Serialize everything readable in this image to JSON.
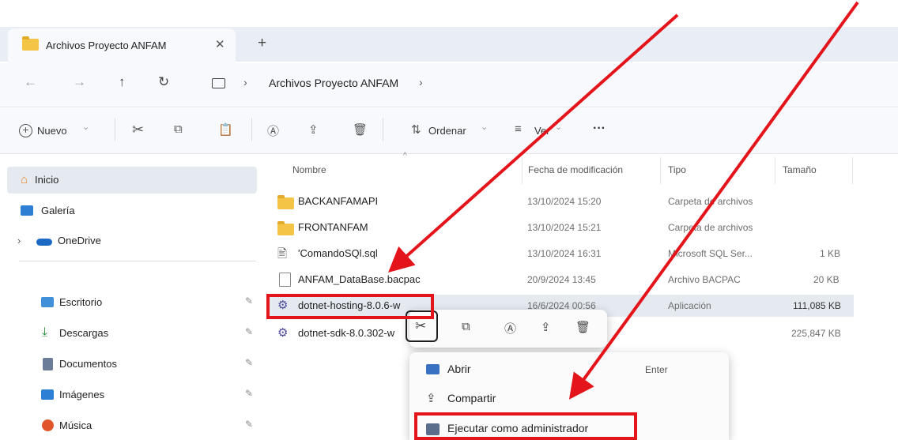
{
  "window": {
    "tab_title": "Archivos Proyecto ANFAM",
    "tab_close": "✕",
    "new_tab": "+"
  },
  "address": {
    "back": "←",
    "forward": "→",
    "up": "↑",
    "refresh": "↻",
    "separator": "›",
    "path_current": "Archivos Proyecto ANFAM"
  },
  "toolbar": {
    "new_label": "Nuevo",
    "sort_label": "Ordenar",
    "view_label": "Ver",
    "more": "···",
    "caret": "⌄"
  },
  "sidebar": {
    "home": "Inicio",
    "gallery": "Galería",
    "onedrive": "OneDrive",
    "expand": "›",
    "pin": "📌",
    "quick_access": [
      {
        "label": "Escritorio",
        "icon": "desktop-icon",
        "color": "#3f8fd9"
      },
      {
        "label": "Descargas",
        "icon": "download-icon",
        "color": "#2a8f3e"
      },
      {
        "label": "Documentos",
        "icon": "documents-icon",
        "color": "#6b7c99"
      },
      {
        "label": "Imágenes",
        "icon": "pictures-icon",
        "color": "#2d7fd4"
      },
      {
        "label": "Música",
        "icon": "music-icon",
        "color": "#e0562a"
      }
    ]
  },
  "columns": {
    "name": "Nombre",
    "modified": "Fecha de modificación",
    "type": "Tipo",
    "size": "Tamaño"
  },
  "files": [
    {
      "name": "BACKANFAMAPI",
      "date": "13/10/2024 15:20",
      "type": "Carpeta de archivos",
      "size": "",
      "icon": "folder-icon"
    },
    {
      "name": "FRONTANFAM",
      "date": "13/10/2024 15:21",
      "type": "Carpeta de archivos",
      "size": "",
      "icon": "folder-icon"
    },
    {
      "name": "'ComandoSQl.sql",
      "date": "13/10/2024 16:31",
      "type": "Microsoft SQL Ser...",
      "size": "1 KB",
      "icon": "sql-file-icon"
    },
    {
      "name": "ANFAM_DataBase.bacpac",
      "date": "20/9/2024 13:45",
      "type": "Archivo BACPAC",
      "size": "20 KB",
      "icon": "file-icon"
    },
    {
      "name": "dotnet-hosting-8.0.6-w",
      "date": "16/6/2024 00:56",
      "type": "Aplicación",
      "size": "111,085 KB",
      "icon": "installer-icon"
    },
    {
      "name": "dotnet-sdk-8.0.302-w",
      "date": "",
      "type": "",
      "size": "225,847 KB",
      "icon": "installer-icon"
    }
  ],
  "context_menu": {
    "open": "Abrir",
    "open_shortcut": "Enter",
    "share": "Compartir",
    "run_as_admin": "Ejecutar como administrador"
  },
  "colors": {
    "highlight": "#e4141b",
    "selection": "#e5eaf1",
    "folder": "#f3c445"
  }
}
